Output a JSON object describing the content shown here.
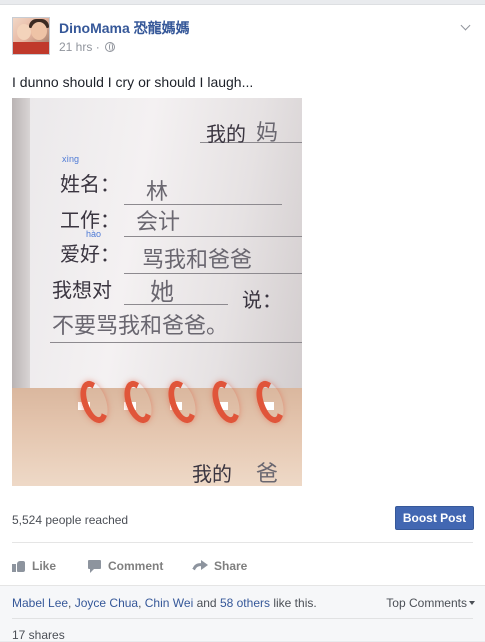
{
  "post": {
    "page_name": "DinoMama 恐龍媽媽",
    "time": "21 hrs",
    "dot": "·",
    "text": "I dunno should I cry or should I laugh...",
    "photo": {
      "lines": {
        "header": "我的",
        "header_fill": "妈",
        "name_pinyin": "xìng",
        "name_label": "姓名：",
        "name_value": "林",
        "job_label": "工作：",
        "job_value": "会计",
        "hobby_pinyin": "hào",
        "hobby_label": "爱好：",
        "hobby_value": "骂我和爸爸",
        "say_label": "我想对",
        "say_value": "她",
        "say_label2": "说：",
        "message": "不要骂我和爸爸。",
        "footer": "我的",
        "footer_fill": "爸"
      }
    }
  },
  "stats": {
    "reach": "5,524 people reached",
    "boost_label": "Boost Post"
  },
  "actions": {
    "like": "Like",
    "comment": "Comment",
    "share": "Share"
  },
  "footer": {
    "liker1": "Mabel Lee",
    "liker2": "Joyce Chua",
    "liker3": "Chin Wei",
    "likes_and": "and",
    "likes_others": "58 others",
    "likes_suffix": "like this.",
    "top_comments": "Top Comments",
    "shares": "17 shares"
  },
  "colors": {
    "link": "#365899",
    "boost": "#4267b2",
    "muted": "#90949c"
  }
}
